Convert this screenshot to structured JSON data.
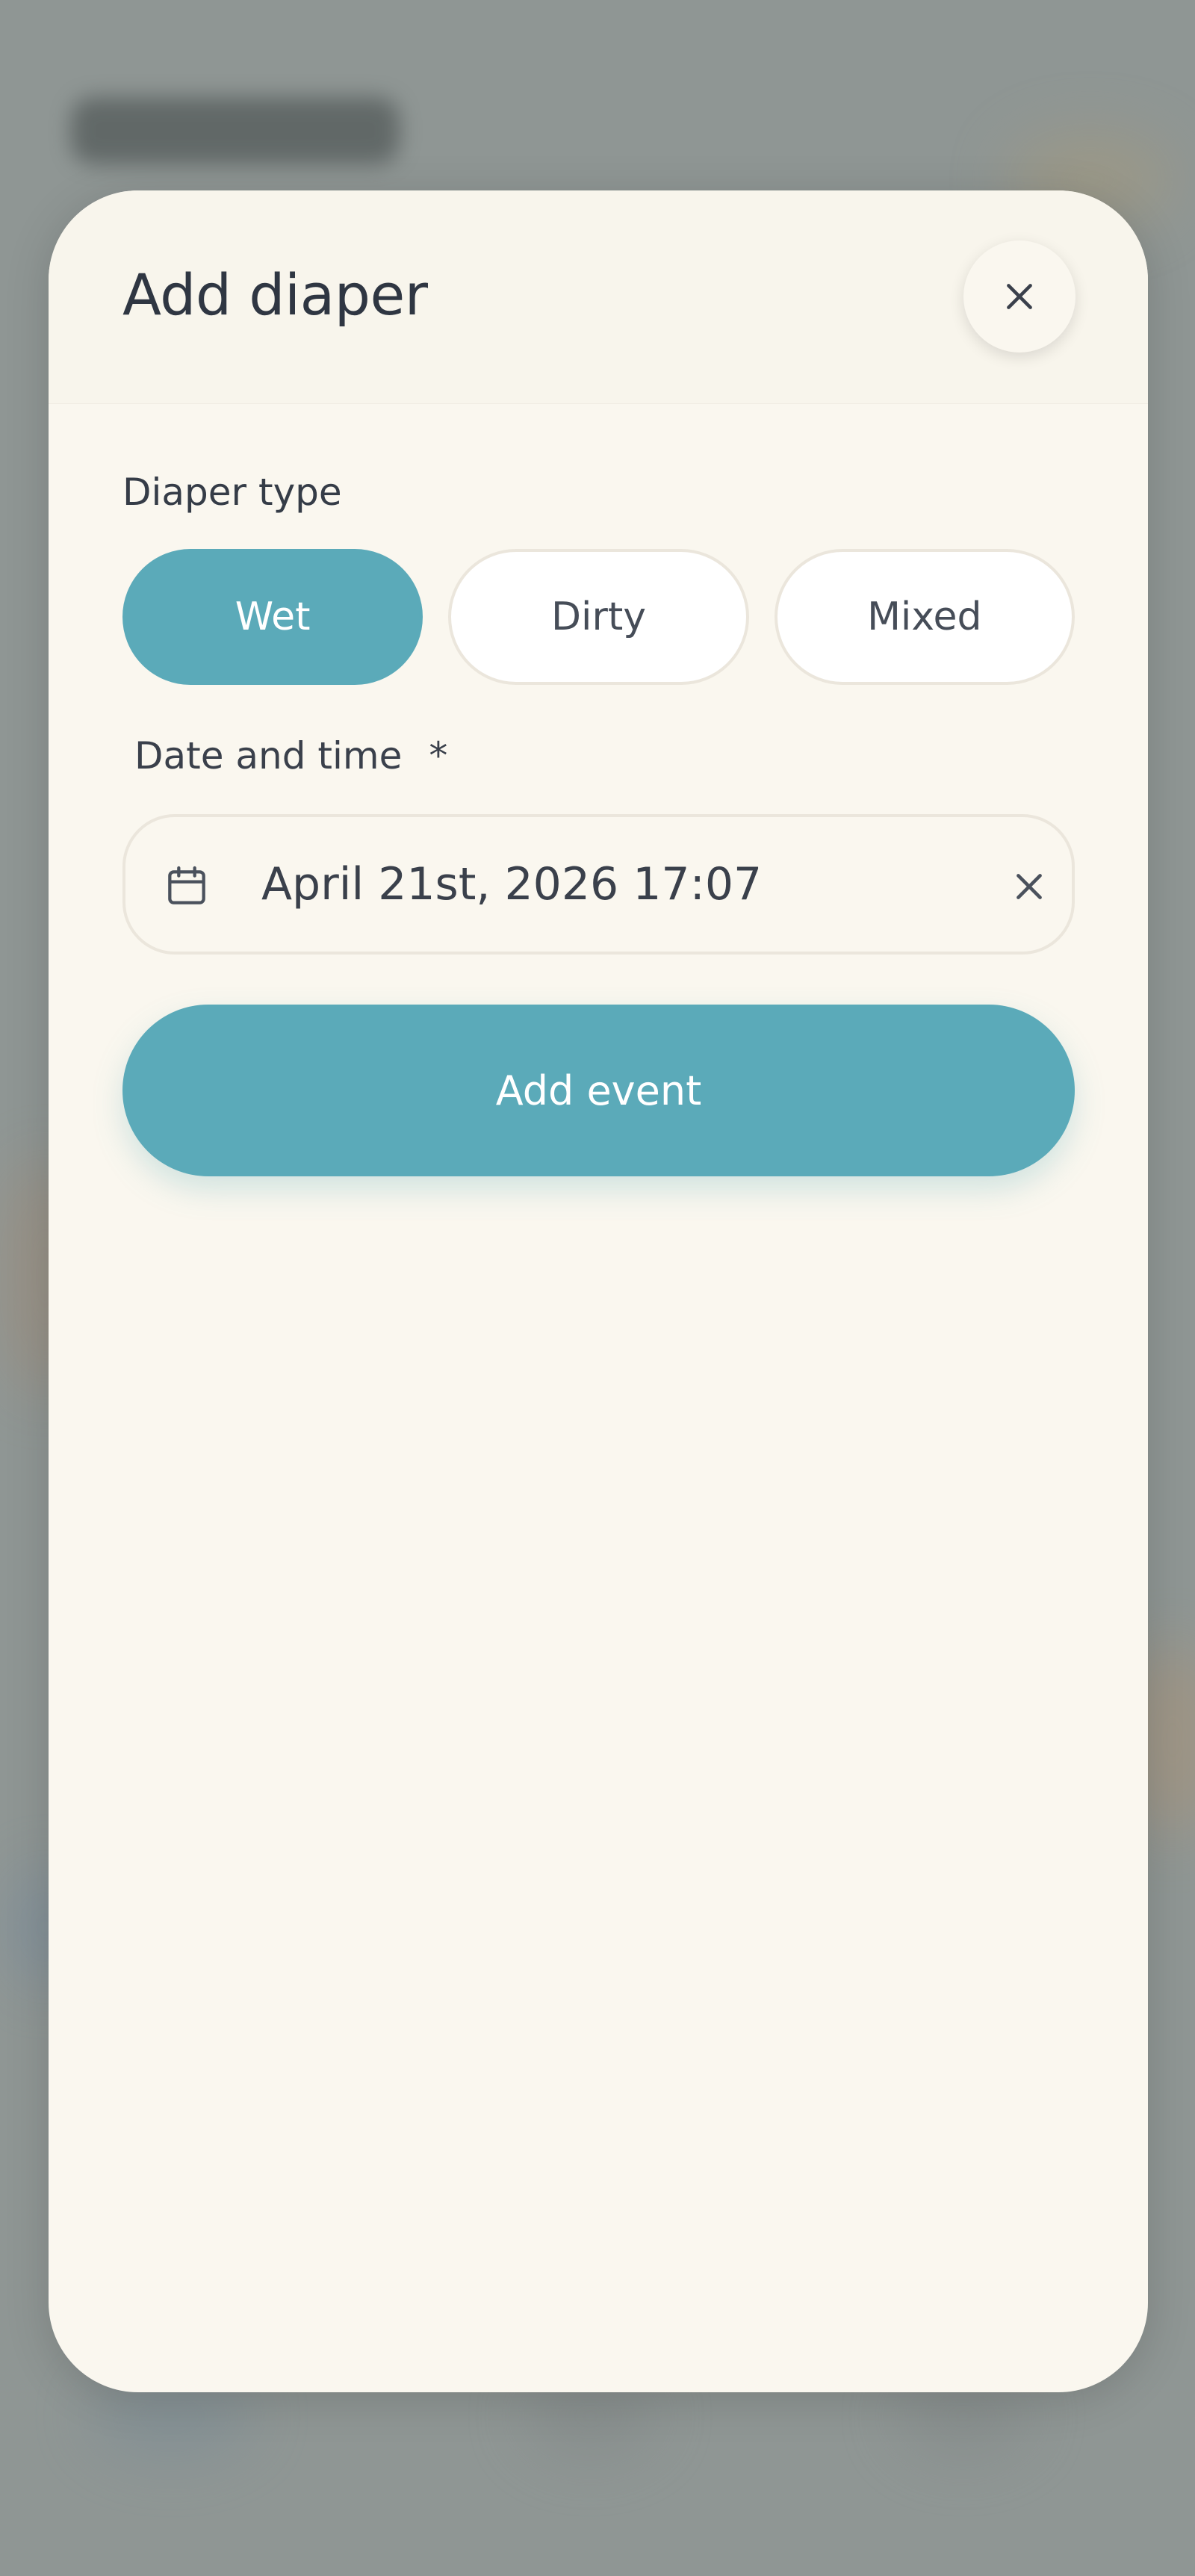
{
  "modal": {
    "title": "Add diaper"
  },
  "diaper_type": {
    "label": "Diaper type",
    "options": [
      "Wet",
      "Dirty",
      "Mixed"
    ],
    "selected": "Wet"
  },
  "date_time": {
    "label": "Date and time",
    "required_marker": "*",
    "value": "April 21st, 2026 17:07"
  },
  "actions": {
    "submit_label": "Add event"
  },
  "colors": {
    "accent": "#5baab9",
    "modal_bg": "#faf7ef",
    "text": "#2f3642"
  },
  "icons": {
    "close": "close-icon",
    "calendar": "calendar-icon",
    "clear": "clear-icon"
  }
}
